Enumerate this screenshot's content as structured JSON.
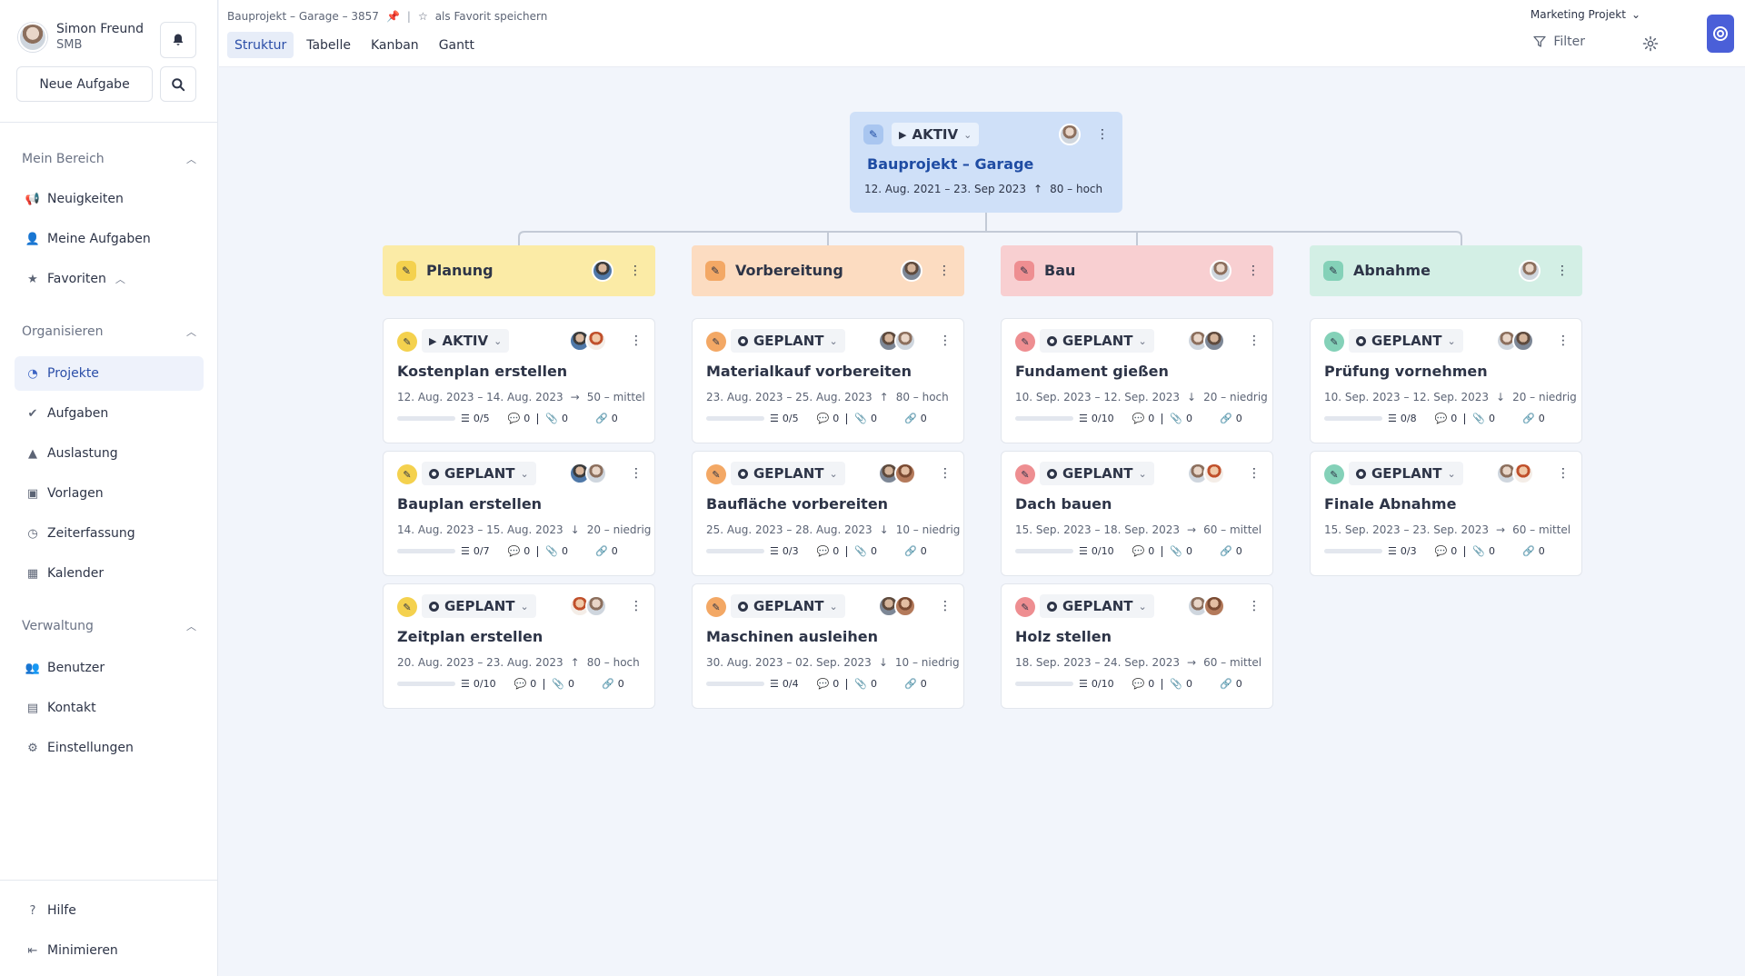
{
  "user": {
    "name": "Simon Freund",
    "org": "SMB"
  },
  "sidebar": {
    "new_task": "Neue Aufgabe",
    "sections": [
      {
        "label": "Mein Bereich",
        "items": [
          {
            "label": "Neuigkeiten",
            "icon": "megaphone-icon"
          },
          {
            "label": "Meine Aufgaben",
            "icon": "user-check-icon"
          },
          {
            "label": "Favoriten",
            "icon": "star-icon"
          }
        ]
      },
      {
        "label": "Organisieren",
        "items": [
          {
            "label": "Projekte",
            "icon": "pie-chart-icon"
          },
          {
            "label": "Aufgaben",
            "icon": "check-circle-icon"
          },
          {
            "label": "Auslastung",
            "icon": "area-chart-icon"
          },
          {
            "label": "Vorlagen",
            "icon": "template-icon"
          },
          {
            "label": "Zeiterfassung",
            "icon": "stopwatch-icon"
          },
          {
            "label": "Kalender",
            "icon": "calendar-icon"
          }
        ]
      },
      {
        "label": "Verwaltung",
        "items": [
          {
            "label": "Benutzer",
            "icon": "users-icon"
          },
          {
            "label": "Kontakt",
            "icon": "contact-card-icon"
          },
          {
            "label": "Einstellungen",
            "icon": "gear-icon"
          }
        ]
      }
    ],
    "footer": [
      {
        "label": "Hilfe",
        "icon": "question-icon"
      },
      {
        "label": "Minimieren",
        "icon": "collapse-left-icon"
      }
    ]
  },
  "topbar": {
    "breadcrumb": "Bauprojekt – Garage – 3857",
    "favorite_label": "als Favorit speichern",
    "tabs": [
      "Struktur",
      "Tabelle",
      "Kanban",
      "Gantt"
    ],
    "active_tab": "Struktur",
    "project_switch": "Marketing Projekt",
    "filter_label": "Filter"
  },
  "colors": {
    "accent": "#3c64c4",
    "root": "#cfe0f8",
    "planung": "#fbeba6",
    "vorbereitung": "#fcdcc1",
    "bau": "#f8cfd1",
    "abnahme": "#d3efe5",
    "logo": "#4a5fd8"
  },
  "root": {
    "status": "AKTIV",
    "title": "Bauprojekt – Garage",
    "dates": "12. Aug. 2021 – 23. Sep 2023",
    "priority": "80 – hoch"
  },
  "phases": [
    {
      "title": "Planung",
      "tasks": [
        {
          "status": "AKTIV",
          "title": "Kostenplan erstellen",
          "dates": "12. Aug. 2023 – 14. Aug. 2023",
          "priority": "50 – mittel",
          "subtasks": "0/5",
          "comments": "0",
          "attachments": "0",
          "links": "0"
        },
        {
          "status": "GEPLANT",
          "title": "Bauplan erstellen",
          "dates": "14. Aug. 2023 – 15. Aug. 2023",
          "priority": "20 – niedrig",
          "subtasks": "0/7",
          "comments": "0",
          "attachments": "0",
          "links": "0"
        },
        {
          "status": "GEPLANT",
          "title": "Zeitplan erstellen",
          "dates": "20. Aug. 2023 – 23. Aug. 2023",
          "priority": "80 – hoch",
          "subtasks": "0/10",
          "comments": "0",
          "attachments": "0",
          "links": "0"
        }
      ]
    },
    {
      "title": "Vorbereitung",
      "tasks": [
        {
          "status": "GEPLANT",
          "title": "Materialkauf vorbereiten",
          "dates": "23. Aug. 2023 – 25. Aug. 2023",
          "priority": "80 – hoch",
          "subtasks": "0/5",
          "comments": "0",
          "attachments": "0",
          "links": "0"
        },
        {
          "status": "GEPLANT",
          "title": "Baufläche vorbereiten",
          "dates": "25. Aug. 2023 – 28. Aug. 2023",
          "priority": "10 – niedrig",
          "subtasks": "0/3",
          "comments": "0",
          "attachments": "0",
          "links": "0"
        },
        {
          "status": "GEPLANT",
          "title": "Maschinen ausleihen",
          "dates": "30. Aug. 2023 – 02. Sep. 2023",
          "priority": "10 – niedrig",
          "subtasks": "0/4",
          "comments": "0",
          "attachments": "0",
          "links": "0"
        }
      ]
    },
    {
      "title": "Bau",
      "tasks": [
        {
          "status": "GEPLANT",
          "title": "Fundament gießen",
          "dates": "10. Sep. 2023 – 12. Sep. 2023",
          "priority": "20 – niedrig",
          "subtasks": "0/10",
          "comments": "0",
          "attachments": "0",
          "links": "0"
        },
        {
          "status": "GEPLANT",
          "title": "Dach bauen",
          "dates": "15. Sep. 2023 – 18. Sep. 2023",
          "priority": "60 – mittel",
          "subtasks": "0/10",
          "comments": "0",
          "attachments": "0",
          "links": "0"
        },
        {
          "status": "GEPLANT",
          "title": "Holz stellen",
          "dates": "18. Sep. 2023 – 24. Sep. 2023",
          "priority": "60 – mittel",
          "subtasks": "0/10",
          "comments": "0",
          "attachments": "0",
          "links": "0"
        }
      ]
    },
    {
      "title": "Abnahme",
      "tasks": [
        {
          "status": "GEPLANT",
          "title": "Prüfung vornehmen",
          "dates": "10. Sep. 2023 – 12. Sep. 2023",
          "priority": "20 – niedrig",
          "subtasks": "0/8",
          "comments": "0",
          "attachments": "0",
          "links": "0"
        },
        {
          "status": "GEPLANT",
          "title": "Finale Abnahme",
          "dates": "15. Sep. 2023 – 23. Sep. 2023",
          "priority": "60 – mittel",
          "subtasks": "0/3",
          "comments": "0",
          "attachments": "0",
          "links": "0"
        }
      ]
    }
  ]
}
